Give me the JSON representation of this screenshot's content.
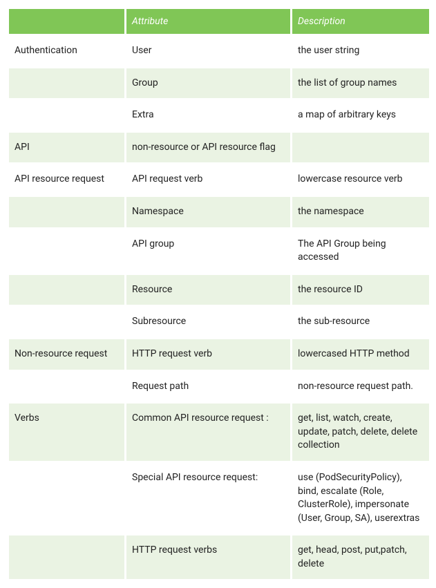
{
  "headers": {
    "col1": "",
    "col2": "Attribute",
    "col3": "Description"
  },
  "rows": [
    {
      "c1": "Authentication",
      "c2": "User",
      "c3": "the user string"
    },
    {
      "c1": "",
      "c2": "Group",
      "c3": "the list of group names"
    },
    {
      "c1": "",
      "c2": "Extra",
      "c3": "a map of arbitrary keys"
    },
    {
      "c1": "API",
      "c2": "non-resource or API resource flag",
      "c3": ""
    },
    {
      "c1": "API resource request",
      "c2": "API request verb",
      "c3": "lowercase resource verb"
    },
    {
      "c1": "",
      "c2": "Namespace",
      "c3": "the namespace"
    },
    {
      "c1": "",
      "c2": "API group",
      "c3": "The API Group being accessed"
    },
    {
      "c1": "",
      "c2": "Resource",
      "c3": "the resource ID"
    },
    {
      "c1": "",
      "c2": "Subresource",
      "c3": "the sub-resource"
    },
    {
      "c1": "Non-resource request",
      "c2": "HTTP request verb",
      "c3": "lowercased HTTP method"
    },
    {
      "c1": "",
      "c2": "Request path",
      "c3": "non-resource request path."
    },
    {
      "c1": "Verbs",
      "c2": "Common API resource request :",
      "c3": "get, list, watch, create, update, patch, delete, delete collection"
    },
    {
      "c1": "",
      "c2": "Special API resource request:",
      "c3": "use (PodSecurityPolicy), bind, escalate (Role, ClusterRole), impersonate (User, Group, SA), userextras"
    },
    {
      "c1": "",
      "c2": "HTTP request verbs",
      "c3": "get, head, post, put,patch, delete"
    }
  ]
}
